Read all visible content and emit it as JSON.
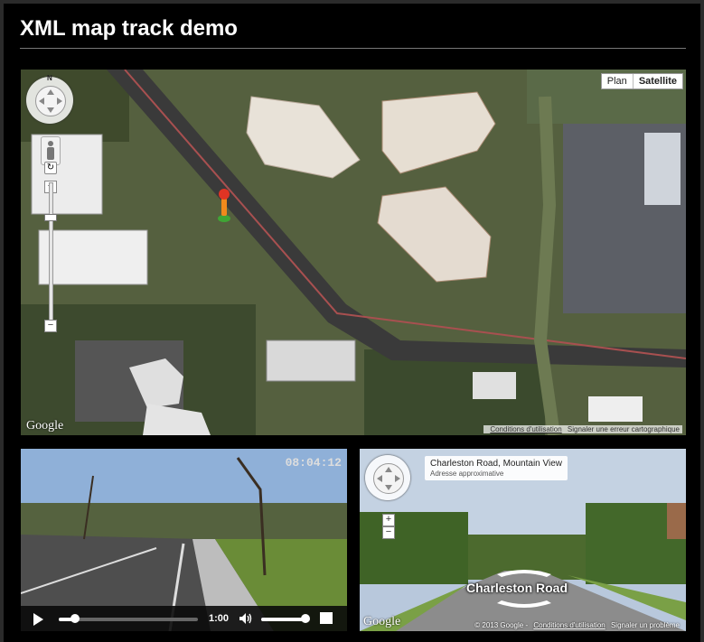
{
  "page": {
    "title": "XML map track demo"
  },
  "map": {
    "maptypes": [
      {
        "label": "Plan",
        "active": false
      },
      {
        "label": "Satellite",
        "active": true
      }
    ],
    "pan_north": "N",
    "zoom_in": "+",
    "zoom_out": "−",
    "logo": "Google",
    "terms_link": "Conditions d'utilisation",
    "report_link": "Signaler une erreur cartographique"
  },
  "video": {
    "timestamp": "08:04:12",
    "duration": "1:00",
    "progress": 0.12,
    "volume": 0.9
  },
  "streetview": {
    "address_line1": "Charleston Road, Mountain View",
    "address_line2": "Adresse approximative",
    "road_label": "Charleston Road",
    "zoom_in": "+",
    "zoom_out": "−",
    "logo": "Google",
    "copyright": "© 2013 Google -",
    "terms_link": "Conditions d'utilisation",
    "report_link": "Signaler un problème"
  }
}
